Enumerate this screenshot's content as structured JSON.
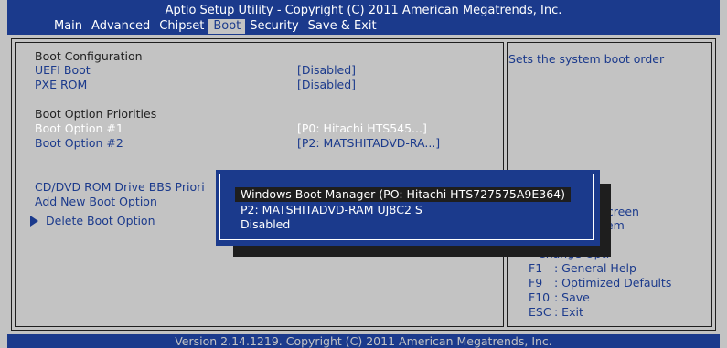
{
  "header": {
    "title": "Aptio Setup Utility - Copyright (C) 2011 American Megatrends, Inc.",
    "tabs": [
      "Main",
      "Advanced",
      "Chipset",
      "Boot",
      "Security",
      "Save & Exit"
    ],
    "active_tab": "Boot"
  },
  "main": {
    "boot_configuration": "Boot Configuration",
    "uefi_boot_label": "UEFI Boot",
    "uefi_boot_value": "[Disabled]",
    "pxe_rom_label": "PXE ROM",
    "pxe_rom_value": "[Disabled]",
    "boot_option_priorities": "Boot Option Priorities",
    "boot_option_1_label": "Boot Option #1",
    "boot_option_1_value": "[P0:  Hitachi HTS545...]",
    "boot_option_2_label": "Boot Option #2",
    "boot_option_2_value": "[P2: MATSHITADVD-RA...]",
    "cddvd_bbs_label": "CD/DVD ROM Drive BBS Priori",
    "add_new_boot_option": "Add New Boot Option",
    "delete_boot_option": "Delete Boot Option"
  },
  "popup": {
    "options": [
      "Windows Boot Manager (PO: Hitachi HTS727575A9E364)",
      "P2: MATSHITADVD-RAM UJ8C2 S",
      "Disabled"
    ],
    "selected_index": 0
  },
  "help": {
    "description": "Sets the system boot order",
    "partial_screen": "Screen",
    "partial_item": "tem",
    "partial_change": "Change Opt.",
    "keys": [
      {
        "key": "F1",
        "desc": ": General Help"
      },
      {
        "key": "F9",
        "desc": ": Optimized Defaults"
      },
      {
        "key": "F10",
        "desc": ": Save"
      },
      {
        "key": "ESC",
        "desc": ": Exit"
      }
    ]
  },
  "footer": {
    "version": "Version 2.14.1219. Copyright (C) 2011 American Megatrends, Inc."
  },
  "colors": {
    "bios_blue": "#1b3a8c",
    "bios_gray": "#c3c3c3",
    "highlight_black": "#1e1e1e"
  }
}
